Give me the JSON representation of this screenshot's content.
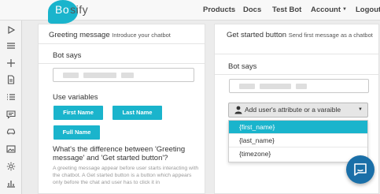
{
  "brand": {
    "logo_bubble_text": "Bo",
    "logo_rest_text": "sify",
    "accent_color": "#1ab4cc"
  },
  "nav": {
    "products": "Products",
    "docs": "Docs",
    "test_bot": "Test Bot",
    "account": "Account",
    "logout": "Logout"
  },
  "sidebar": {
    "items": [
      {
        "icon": "play-icon"
      },
      {
        "icon": "menu-icon"
      },
      {
        "icon": "plus-icon"
      },
      {
        "icon": "document-icon"
      },
      {
        "icon": "list-icon"
      },
      {
        "icon": "chat-icon"
      },
      {
        "icon": "car-icon"
      },
      {
        "icon": "image-icon"
      },
      {
        "icon": "gear-icon"
      },
      {
        "icon": "bar-chart-icon"
      }
    ]
  },
  "greeting": {
    "title": "Greeting message",
    "subtitle": "Introduce your chatbot",
    "bot_says_label": "Bot says",
    "use_variables_label": "Use variables",
    "variables": [
      "First Name",
      "Last Name",
      "Full Name"
    ],
    "question": "What's the difference between 'Greeting message' and 'Get started button'?",
    "answer": "A greeting message appear before user starts interacting with the chatbot. A Get started button is a button which appears only before the chat and user has to click it in"
  },
  "get_started": {
    "title": "Get started button",
    "subtitle": "Send first message as a chatbot",
    "bot_says_label": "Bot says",
    "dropdown_label": "Add user's attribute or a varaible",
    "options": [
      "{first_name}",
      "{last_name}",
      "{timezone}"
    ],
    "selected_index": 0
  },
  "chat_widget": {
    "icon": "chat-bubble-icon"
  }
}
